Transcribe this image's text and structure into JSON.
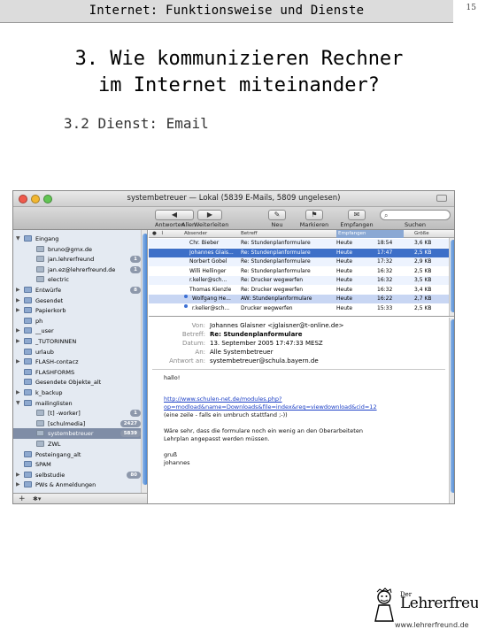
{
  "header": {
    "text": "Internet: Funktionsweise und Dienste",
    "page": "15"
  },
  "title": {
    "line1": "3. Wie kommunizieren Rechner",
    "line2": "im Internet miteinander?"
  },
  "subtitle": "3.2 Dienst: Email",
  "window": {
    "title": "systembetreuer — Lokal (5839 E-Mails, 5809 ungelesen)",
    "toolbar": {
      "antworten": "Antworten",
      "allen": "Allen",
      "weiterleiten": "Weiterleiten",
      "neu": "Neu",
      "markieren": "Markieren",
      "empfangen": "Empfangen",
      "suchen": "Suchen"
    },
    "sidebar": {
      "items": [
        {
          "label": "Eingang",
          "level": 0,
          "tri": "▼"
        },
        {
          "label": "bruno@gmx.de",
          "level": 1
        },
        {
          "label": "jan.lehrerfreund",
          "level": 1,
          "badge": "1"
        },
        {
          "label": "jan.ez@lehrerfreund.de",
          "level": 1,
          "badge": "1"
        },
        {
          "label": "electric",
          "level": 1
        },
        {
          "label": "Entwürfe",
          "level": 0,
          "tri": "▶",
          "badge": "8"
        },
        {
          "label": "Gesendet",
          "level": 0,
          "tri": "▶"
        },
        {
          "label": "Papierkorb",
          "level": 0,
          "tri": "▶"
        },
        {
          "label": "ph",
          "level": 0
        },
        {
          "label": "__user",
          "level": 0,
          "tri": "▶"
        },
        {
          "label": "_TUTORINNEN",
          "level": 0,
          "tri": "▶"
        },
        {
          "label": "urlaub",
          "level": 0
        },
        {
          "label": "FLASH-contacz",
          "level": 0,
          "tri": "▶"
        },
        {
          "label": "FLASHFORMS",
          "level": 0
        },
        {
          "label": "Gesendete Objekte_alt",
          "level": 0
        },
        {
          "label": "k_backup",
          "level": 0,
          "tri": "▶"
        },
        {
          "label": "mailinglisten",
          "level": 0,
          "tri": "▼"
        },
        {
          "label": "[t] -worker]",
          "level": 1,
          "badge": "1"
        },
        {
          "label": "[schulmedia]",
          "level": 1,
          "badge": "2427"
        },
        {
          "label": "systembetreuer",
          "level": 1,
          "badge": "5839",
          "selected": true
        },
        {
          "label": "ZWL",
          "level": 1
        },
        {
          "label": "Posteingang_alt",
          "level": 0
        },
        {
          "label": "SPAM",
          "level": 0
        },
        {
          "label": "selbstudie",
          "level": 0,
          "tri": "▶",
          "badge": "80"
        },
        {
          "label": "PWs & Anmeldungen",
          "level": 0,
          "tri": "▶"
        }
      ],
      "footer_add": "+",
      "footer_gear": "✱▾"
    },
    "message_list": {
      "columns": {
        "absender": "Absender",
        "betreff": "Betreff",
        "datum": "Empfangen",
        "groesse": "Größe"
      },
      "rows": [
        {
          "from": "Chr. Bieber",
          "subject": "Re: Stundenplanformulare",
          "date": "Heute",
          "time": "18:54",
          "size": "3,6 KB",
          "style": "alt",
          "dot": false
        },
        {
          "from": "Johannes Glais...",
          "subject": "Re: Stundenplanformulare",
          "date": "Heute",
          "time": "17:47",
          "size": "2,5 KB",
          "style": "sel",
          "dot": false
        },
        {
          "from": "Norbert Gobel",
          "subject": "Re: Stundenplanformulare",
          "date": "Heute",
          "time": "17:32",
          "size": "2,9 KB",
          "style": "alt",
          "dot": false
        },
        {
          "from": "Willi Hellinger",
          "subject": "Re: Stundenplanformulare",
          "date": "Heute",
          "time": "16:32",
          "size": "2,5 KB",
          "style": "",
          "dot": false
        },
        {
          "from": "r.keller@sch...",
          "subject": "Re: Drucker wegwerfen",
          "date": "Heute",
          "time": "16:32",
          "size": "3,5 KB",
          "style": "alt",
          "dot": false
        },
        {
          "from": "Thomas Kienzle",
          "subject": "Re: Drucker wegwerfen",
          "date": "Heute",
          "time": "16:32",
          "size": "3,4 KB",
          "style": "",
          "dot": false
        },
        {
          "from": "Wolfgang He...",
          "subject": "AW: Stundenplanformulare",
          "date": "Heute",
          "time": "16:22",
          "size": "2,7 KB",
          "style": "hl",
          "dot": true
        },
        {
          "from": "r.keller@sch...",
          "subject": "Drucker wegwerfen",
          "date": "Heute",
          "time": "15:33",
          "size": "2,5 KB",
          "style": "",
          "dot": true
        }
      ]
    },
    "preview": {
      "von_label": "Von:",
      "von": "Johannes Glaisner <jglaisner@t-online.de>",
      "betreff_label": "Betreff:",
      "betreff": "Re: Stundenplanformulare",
      "datum_label": "Datum:",
      "datum": "13. September 2005 17:47:33 MESZ",
      "an_label": "An:",
      "an": "Alle Systembetreuer",
      "antwort_label": "Antwort an:",
      "antwort": "systembetreuer@schula.bayern.de",
      "body": [
        {
          "text": "hallo!",
          "link": false
        },
        {
          "text": "http://www.schulen-net.de/modules.php?",
          "link": true
        },
        {
          "text": "op=modload&name=Downloads&file=index&req=viewdownload&cid=12",
          "link": true
        },
        {
          "text": "(eine zeile - falls ein umbruch stattfand ;-))",
          "link": false
        },
        {
          "text": "Wäre sehr, dass die formulare noch ein wenig an den Oberarbeiteten",
          "link": false
        },
        {
          "text": "Lehrplan angepasst werden müssen.",
          "link": false
        },
        {
          "text": "gruß",
          "link": false
        },
        {
          "text": "johannes",
          "link": false
        }
      ]
    }
  },
  "logo": {
    "word": "Lehrerfreund",
    "prefix": "Der",
    "url": "www.lehrerfreund.de"
  },
  "colors": {
    "selection": "#3d6fc8",
    "sidebar_bg": "#e4eaf2",
    "link": "#1a3ec6"
  }
}
